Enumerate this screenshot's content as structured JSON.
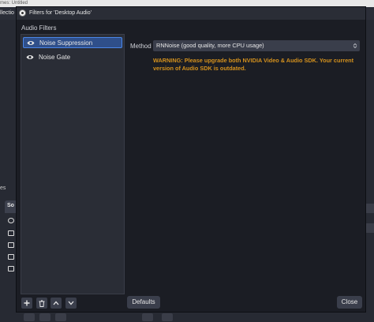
{
  "background_window": {
    "title_fragment": "mes: Untitled",
    "collection_fragment": "llectio",
    "side_label": "es",
    "sources_tab": "So"
  },
  "dialog": {
    "title": "Filters for 'Desktop Audio'",
    "section_label": "Audio Filters",
    "filters": [
      {
        "label": "Noise Suppression",
        "selected": true,
        "icon": "eye-icon"
      },
      {
        "label": "Noise Gate",
        "selected": false,
        "icon": "eye-icon"
      }
    ],
    "toolbar": [
      {
        "name": "add-filter-button",
        "icon": "plus-icon"
      },
      {
        "name": "remove-filter-button",
        "icon": "trash-icon"
      },
      {
        "name": "move-up-button",
        "icon": "chevron-up-icon"
      },
      {
        "name": "move-down-button",
        "icon": "chevron-down-icon"
      }
    ],
    "settings": {
      "method_label": "Method",
      "method_value": "RNNoise (good quality, more CPU usage)",
      "warning": "WARNING: Please upgrade both NVIDIA Video & Audio SDK. Your current version of Audio SDK is outdated."
    },
    "defaults_label": "Defaults",
    "close_label": "Close"
  },
  "colors": {
    "accent": "#4a86e8",
    "selected_bg": "#2f4f8a",
    "warning": "#d4911d",
    "dialog_bg": "#1b1d24",
    "panel_bg": "#2a2d36",
    "control_bg": "#3a3e4b"
  }
}
